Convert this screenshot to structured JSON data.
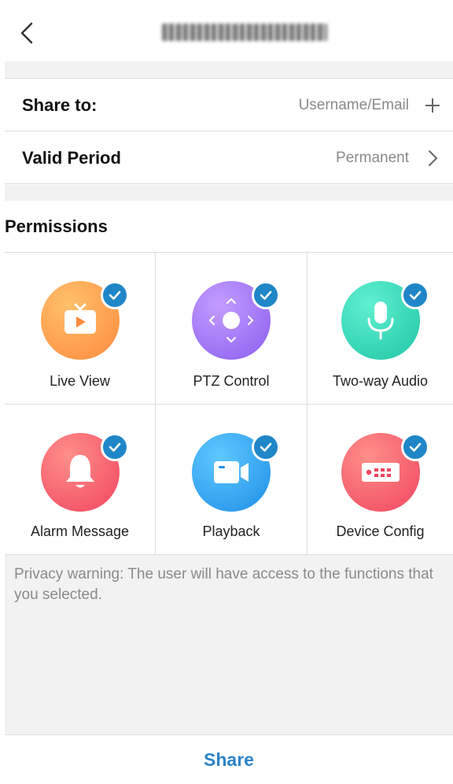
{
  "header": {
    "back_icon": "chevron-left-icon"
  },
  "share_to": {
    "label": "Share to:",
    "value": "Username/Email",
    "icon": "plus-icon"
  },
  "valid_period": {
    "label": "Valid Period",
    "value": "Permanent",
    "icon": "chevron-right-icon"
  },
  "permissions": {
    "title": "Permissions",
    "items": [
      {
        "label": "Live View",
        "icon": "tv-icon",
        "checked": true,
        "color": "#ff9a4a"
      },
      {
        "label": "PTZ Control",
        "icon": "ptz-icon",
        "checked": true,
        "color": "#9a6ff2"
      },
      {
        "label": "Two-way Audio",
        "icon": "microphone-icon",
        "checked": true,
        "color": "#2ed3b6"
      },
      {
        "label": "Alarm Message",
        "icon": "bell-icon",
        "checked": true,
        "color": "#f5566b"
      },
      {
        "label": "Playback",
        "icon": "video-camera-icon",
        "checked": true,
        "color": "#2f9ff0"
      },
      {
        "label": "Device Config",
        "icon": "device-icon",
        "checked": true,
        "color": "#f5566b"
      }
    ]
  },
  "privacy_warning": "Privacy warning: The user will have access to the functions that you selected.",
  "share_button": "Share",
  "colors": {
    "accent": "#2b83c9",
    "check": "#1f86c8"
  }
}
